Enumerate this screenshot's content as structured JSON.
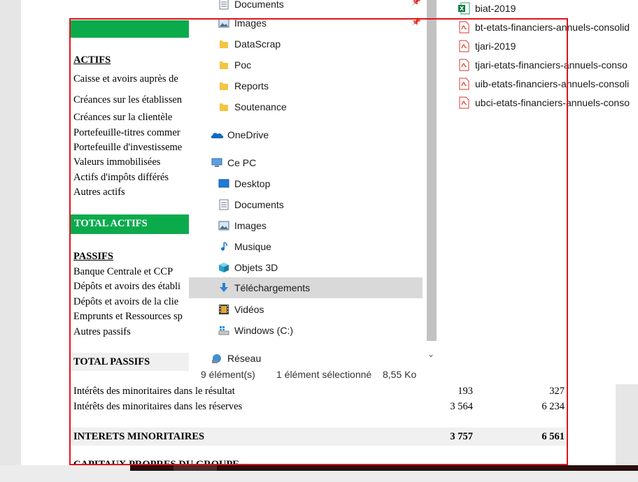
{
  "document": {
    "actifs_title": "ACTIFS",
    "actifs_items": [
      "Caisse et avoirs auprès de",
      "Créances sur les établissen",
      "Créances sur la clientèle",
      "Portefeuille-titres commer",
      "Portefeuille d'investisseme",
      "Valeurs immobilisées",
      "Actifs d'impôts différés",
      "Autres actifs"
    ],
    "total_actifs": "TOTAL ACTIFS",
    "passifs_title": "PASSIFS",
    "passifs_items": [
      "Banque Centrale et CCP",
      "Dépôts et avoirs des établi",
      "Dépôts et avoirs de la clie",
      "Emprunts et Ressources sp",
      "Autres passifs"
    ],
    "total_passifs": "TOTAL PASSIFS",
    "minoritaires_rows": [
      {
        "label": "Intérêts des minoritaires dans le résultat",
        "v1": "193",
        "v2": "327"
      },
      {
        "label": "Intérêts des minoritaires dans les réserves",
        "v1": "3 564",
        "v2": "6 234"
      }
    ],
    "interets_total": {
      "label": "INTERETS MINORITAIRES",
      "v1": "3 757",
      "v2": "6 561"
    },
    "cut_heading": "CAPITAUX PROPRES DU GROUPE"
  },
  "explorer": {
    "nav_items": [
      {
        "label": "Documents",
        "icon": "documents-icon",
        "pinned": true
      },
      {
        "label": "Images",
        "icon": "images-icon",
        "pinned": true
      },
      {
        "label": "DataScrap",
        "icon": "folder-icon"
      },
      {
        "label": "Poc",
        "icon": "folder-icon"
      },
      {
        "label": "Reports",
        "icon": "folder-icon"
      },
      {
        "label": "Soutenance",
        "icon": "folder-icon"
      },
      {
        "label": "OneDrive",
        "icon": "onedrive-icon"
      },
      {
        "label": "Ce PC",
        "icon": "pc-icon"
      },
      {
        "label": "Desktop",
        "icon": "desktop-icon"
      },
      {
        "label": "Documents",
        "icon": "documents-icon"
      },
      {
        "label": "Images",
        "icon": "images-icon"
      },
      {
        "label": "Musique",
        "icon": "music-icon"
      },
      {
        "label": "Objets 3D",
        "icon": "3d-objects-icon"
      },
      {
        "label": "Téléchargements",
        "icon": "downloads-icon",
        "selected": true
      },
      {
        "label": "Vidéos",
        "icon": "videos-icon"
      },
      {
        "label": "Windows (C:)",
        "icon": "drive-icon"
      },
      {
        "label": "Réseau",
        "icon": "network-icon"
      }
    ],
    "files": [
      {
        "name": "biat-2019",
        "icon": "excel-icon"
      },
      {
        "name": "bt-etats-financiers-annuels-consolid",
        "icon": "pdf-icon"
      },
      {
        "name": "tjari-2019",
        "icon": "pdf-icon"
      },
      {
        "name": "tjari-etats-financiers-annuels-conso",
        "icon": "pdf-icon"
      },
      {
        "name": "uib-etats-financiers-annuels-consoli",
        "icon": "pdf-icon"
      },
      {
        "name": "ubci-etats-financiers-annuels-conso",
        "icon": "pdf-icon"
      }
    ],
    "status": {
      "count": "9 élément(s)",
      "selection": "1 élément sélectionné",
      "size": "8,55 Ko"
    }
  }
}
